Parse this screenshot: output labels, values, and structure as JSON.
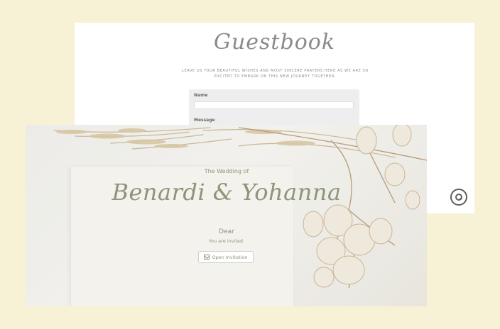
{
  "guestbook": {
    "title": "Guestbook",
    "subtitle": "LEAVE US YOUR BEAUTIFUL WISHES AND MOST SINCERE PRAYERS HERE AS WE ARE SO EXCITED TO EMBARK ON THIS NEW JOURNEY TOGETHER.",
    "name_label": "Name",
    "name_value": "",
    "message_label": "Message"
  },
  "music_button": {
    "icon": "disc-icon"
  },
  "cover": {
    "wedding_of": "The Wedding of",
    "names": "Benardi & Yohanna",
    "dear": "Dear",
    "invited": "You are invited.",
    "open_button": "Open Invitation",
    "open_icon": "envelope-open-icon"
  },
  "colors": {
    "page_background": "#f7f1d5",
    "accent_olive": "#8e9479",
    "title_gray": "#8a8a8a"
  }
}
